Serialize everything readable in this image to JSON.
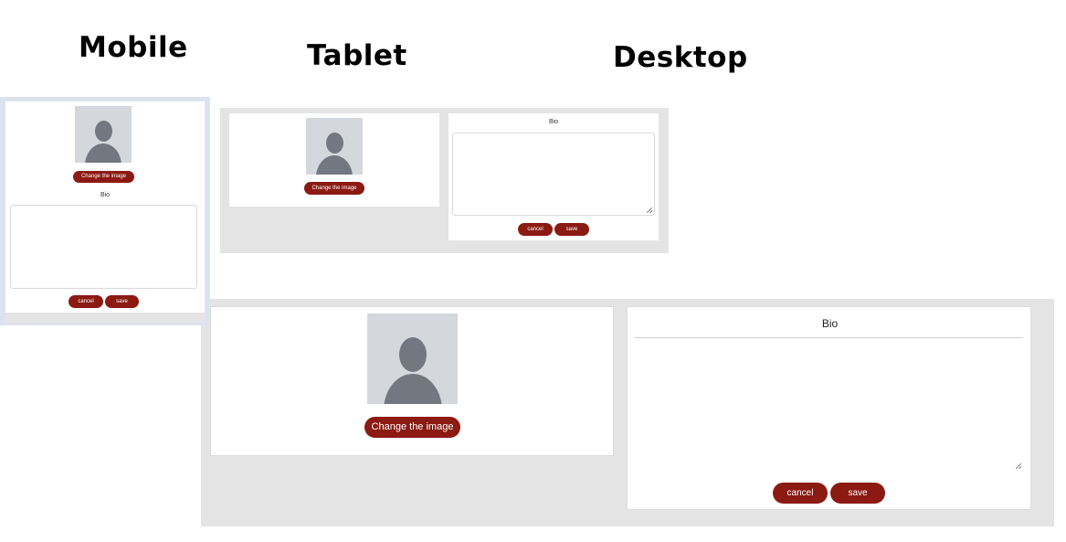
{
  "headings": {
    "mobile": "Mobile",
    "tablet": "Tablet",
    "desktop": "Desktop"
  },
  "mobile": {
    "change_image_label": "Change the image",
    "bio_label": "Bio",
    "bio_value": "",
    "cancel_label": "cancel",
    "save_label": "save"
  },
  "tablet": {
    "change_image_label": "Change the image",
    "bio_label": "Bio",
    "bio_value": "",
    "cancel_label": "cancel",
    "save_label": "save"
  },
  "desktop": {
    "change_image_label": "Change the image",
    "bio_label": "Bio",
    "bio_value": "",
    "cancel_label": "cancel",
    "save_label": "save"
  },
  "colors": {
    "button": "#8b1a12",
    "frame_gray": "#e4e4e4",
    "mobile_frame": "#dde3ee",
    "avatar_bg": "#d4d7dc",
    "avatar_fg": "#737880"
  }
}
